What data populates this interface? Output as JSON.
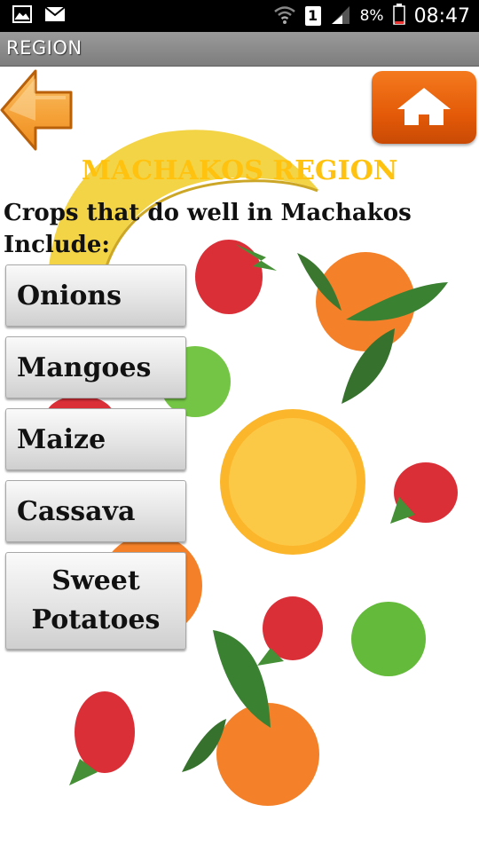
{
  "status_bar": {
    "battery": "8%",
    "time": "08:47",
    "sim": "1",
    "icons": [
      "image-icon",
      "mail-icon",
      "wifi-icon",
      "sim-icon",
      "signal-icon",
      "battery-icon"
    ]
  },
  "titlebar": {
    "title": "REGION"
  },
  "nav": {
    "back_icon": "back-arrow-icon",
    "home_icon": "home-icon"
  },
  "page": {
    "region_title": "MACHAKOS REGION",
    "intro": "Crops that do well in Machakos Include:"
  },
  "crops": [
    {
      "label": "Onions"
    },
    {
      "label": "Mangoes"
    },
    {
      "label": "Maize"
    },
    {
      "label": "Cassava"
    },
    {
      "label": "Sweet Potatoes"
    }
  ],
  "colors": {
    "title": "#ffc20e",
    "home_button": "#e45a08",
    "back_arrow": "#f5a33a"
  }
}
